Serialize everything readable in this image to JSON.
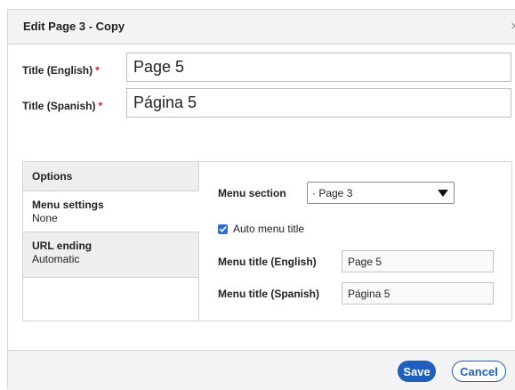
{
  "dialog": {
    "title": "Edit Page 3 - Copy",
    "close_glyph": "×",
    "close_icon": "close-icon"
  },
  "fields": {
    "title_english": {
      "label": "Title (English)",
      "required_mark": "*",
      "value": "Page 5"
    },
    "title_spanish": {
      "label": "Title (Spanish)",
      "required_mark": "*",
      "value": "Página 5"
    }
  },
  "tabs": [
    {
      "title": "Options",
      "subtitle": ""
    },
    {
      "title": "Menu settings",
      "subtitle": "None",
      "active": true
    },
    {
      "title": "URL ending",
      "subtitle": "Automatic"
    }
  ],
  "menu_settings": {
    "section_label": "Menu section",
    "section_value": "· Page 3",
    "auto_title_label": "Auto menu title",
    "auto_title_checked": true,
    "menu_title_english_label": "Menu title (English)",
    "menu_title_english_value": "Page 5",
    "menu_title_spanish_label": "Menu title (Spanish)",
    "menu_title_spanish_value": "Página 5"
  },
  "footer": {
    "save_label": "Save",
    "cancel_label": "Cancel"
  },
  "colors": {
    "accent": "#1f5fbd",
    "required": "#d8232a",
    "checkbox": "#2a6fdb"
  }
}
